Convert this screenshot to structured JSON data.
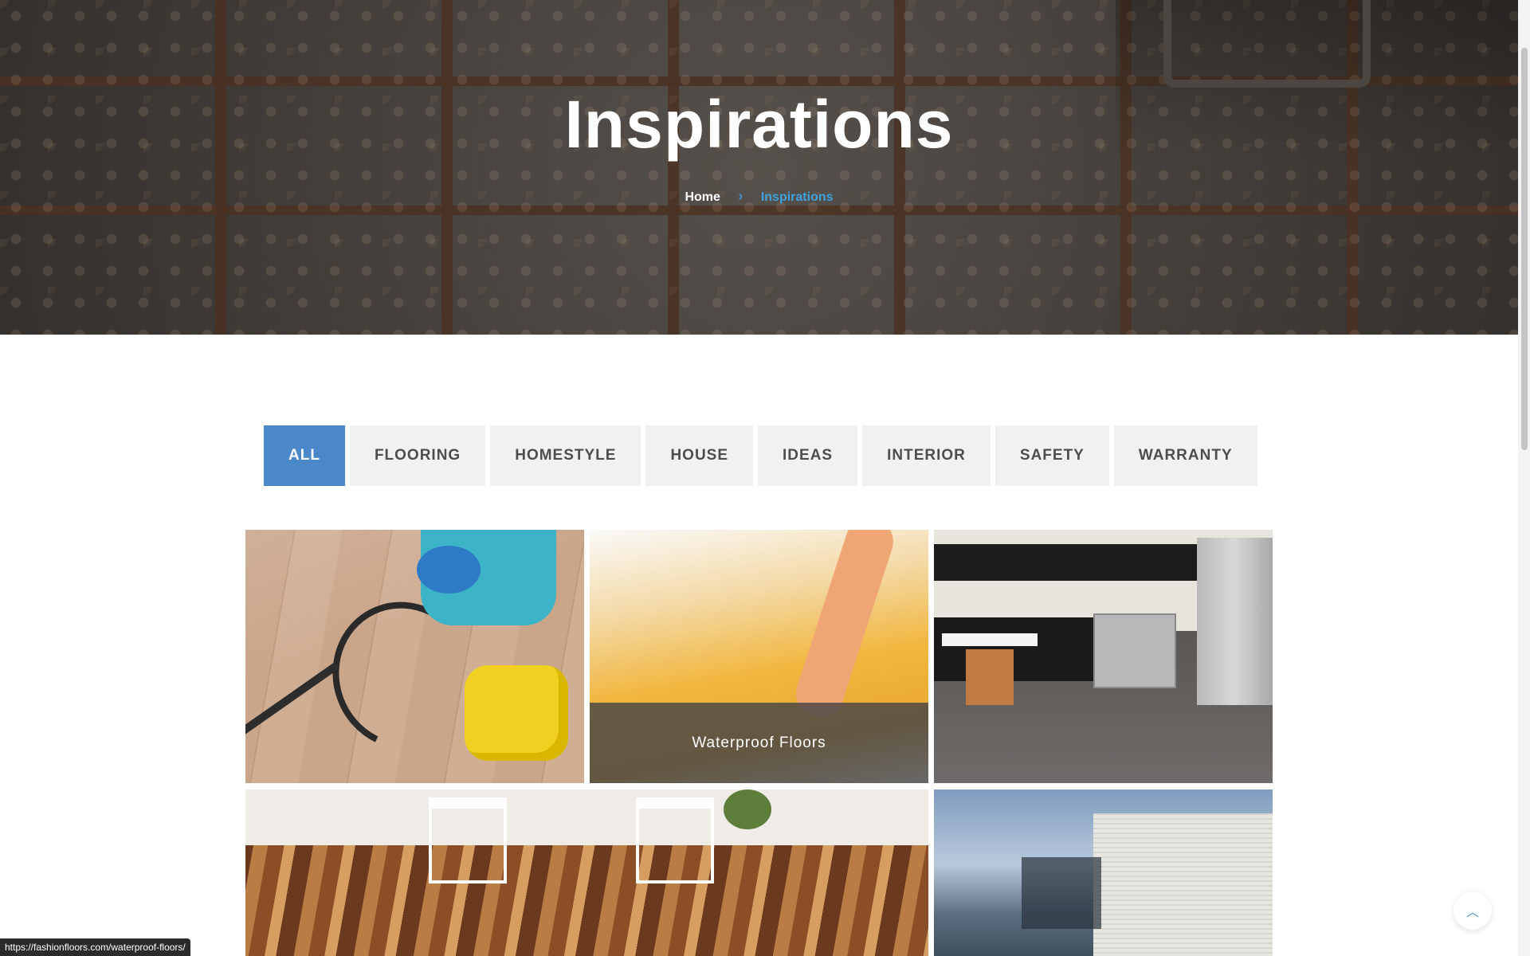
{
  "hero": {
    "title": "Inspirations",
    "breadcrumb": {
      "home": "Home",
      "separator_icon": "chevron-right-icon",
      "current": "Inspirations"
    }
  },
  "filters": [
    {
      "label": "ALL",
      "active": true
    },
    {
      "label": "FLOORING",
      "active": false
    },
    {
      "label": "HOMESTYLE",
      "active": false
    },
    {
      "label": "HOUSE",
      "active": false
    },
    {
      "label": "IDEAS",
      "active": false
    },
    {
      "label": "INTERIOR",
      "active": false
    },
    {
      "label": "SAFETY",
      "active": false
    },
    {
      "label": "WARRANTY",
      "active": false
    }
  ],
  "grid": {
    "hovered_caption": "Waterproof Floors"
  },
  "status_bar": {
    "url": "https://fashionfloors.com/waterproof-floors/"
  },
  "scroll_top": {
    "icon": "chevron-up-icon"
  },
  "colors": {
    "accent": "#4a88c9",
    "breadcrumb_current": "#3fa2dd",
    "filter_bg": "#f1f1f1"
  }
}
